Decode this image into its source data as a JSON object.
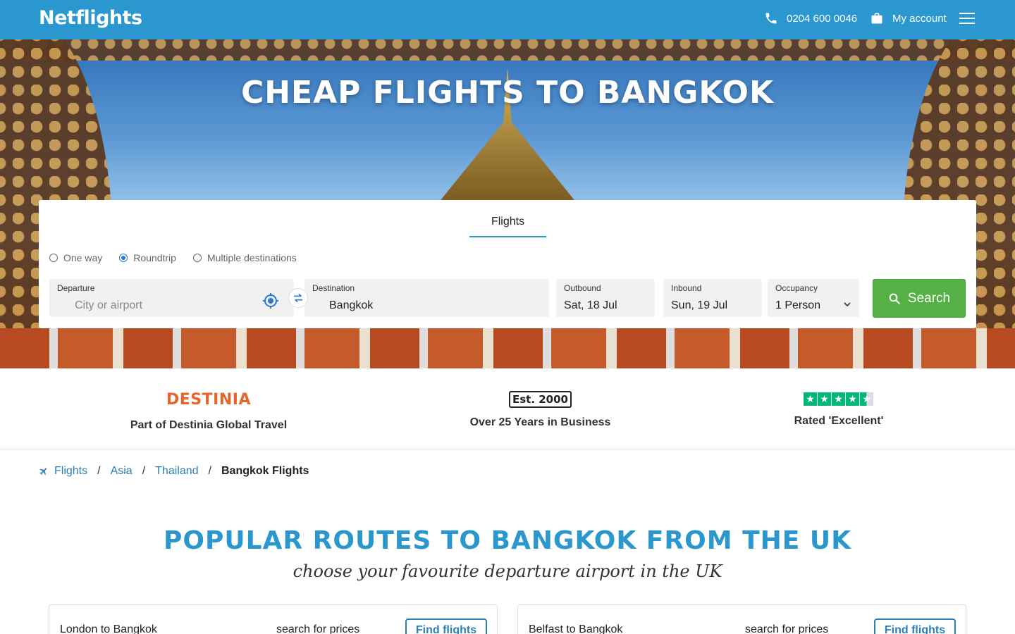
{
  "header": {
    "logo": "Netflights",
    "phone": "0204 600 0046",
    "account_label": "My account",
    "brand_color": "#2a97cf"
  },
  "hero": {
    "title": "CHEAP FLIGHTS TO BANGKOK"
  },
  "search": {
    "tab_label": "Flights",
    "trip_types": [
      "One way",
      "Roundtrip",
      "Multiple destinations"
    ],
    "selected_trip_type": "Roundtrip",
    "departure": {
      "label": "Departure",
      "placeholder": "City or airport",
      "value": ""
    },
    "destination": {
      "label": "Destination",
      "value": "Bangkok"
    },
    "outbound": {
      "label": "Outbound",
      "value": "Sat, 18 Jul"
    },
    "inbound": {
      "label": "Inbound",
      "value": "Sun, 19 Jul"
    },
    "occupancy": {
      "label": "Occupancy",
      "value": "1 Person"
    },
    "search_button": "Search",
    "search_button_color": "#55b146"
  },
  "trust": [
    {
      "logo_text": "DESTINIA",
      "caption": "Part of Destinia Global Travel"
    },
    {
      "logo_text": "Est. 2000",
      "caption": "Over 25 Years in Business"
    },
    {
      "caption": "Rated 'Excellent'",
      "rating_stars": 4.5
    }
  ],
  "breadcrumb": {
    "items": [
      "Flights",
      "Asia",
      "Thailand"
    ],
    "current": "Bangkok Flights"
  },
  "routes": {
    "title": "POPULAR ROUTES TO BANGKOK FROM THE UK",
    "subtitle": "choose your favourite departure airport in the UK",
    "cards": [
      {
        "name": "London to Bangkok",
        "price_text": "search for prices",
        "button": "Find flights"
      },
      {
        "name": "Belfast to Bangkok",
        "price_text": "search for prices",
        "button": "Find flights"
      }
    ]
  }
}
